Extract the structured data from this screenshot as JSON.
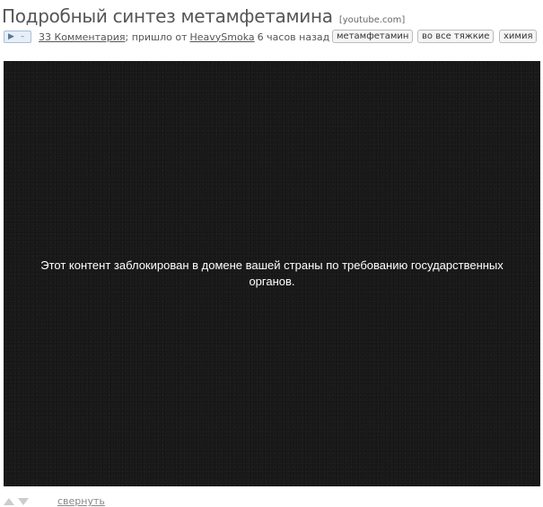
{
  "post": {
    "title": "Подробный синтез метамфетамина",
    "source": "[youtube.com]"
  },
  "meta": {
    "play_symbol": "▶",
    "dash_symbol": "–",
    "comments_link": "33 Комментария",
    "posted_by_text": "; пришло от",
    "author": "HeavySmoka",
    "time_ago": "6 часов назад"
  },
  "tags": [
    "метамфетамин",
    "во все тяжкие",
    "химия"
  ],
  "video": {
    "blocked_message": "Этот контент заблокирован в домене вашей страны по требованию государственных органов."
  },
  "footer": {
    "collapse_label": "свернуть"
  }
}
